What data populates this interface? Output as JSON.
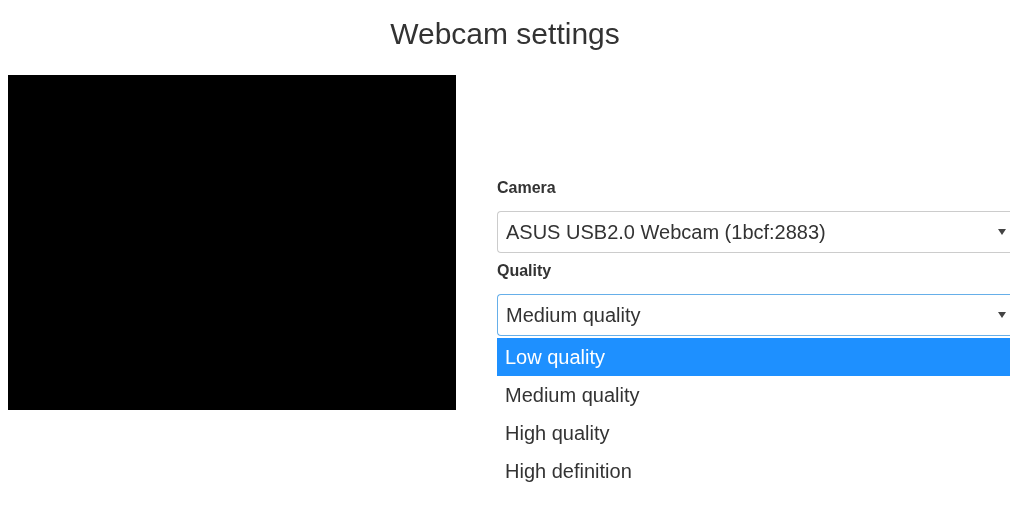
{
  "title": "Webcam settings",
  "fields": [
    {
      "label": "Camera",
      "value": "ASUS USB2.0 Webcam (1bcf:2883)",
      "expanded": false
    },
    {
      "label": "Quality",
      "value": "Medium quality",
      "expanded": true,
      "options": [
        {
          "label": "Low quality",
          "highlighted": true
        },
        {
          "label": "Medium quality",
          "highlighted": false
        },
        {
          "label": "High quality",
          "highlighted": false
        },
        {
          "label": "High definition",
          "highlighted": false
        }
      ]
    }
  ]
}
